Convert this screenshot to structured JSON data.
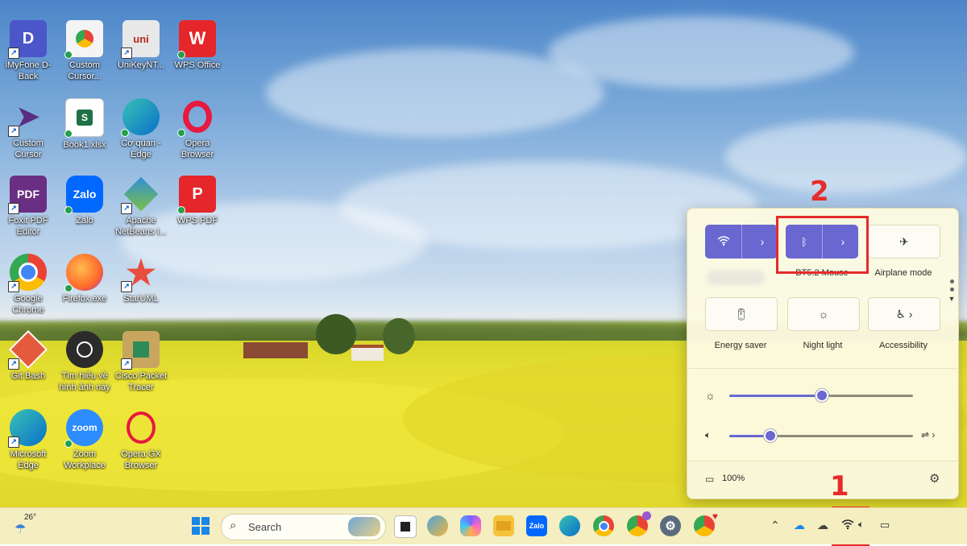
{
  "desktop_icons": [
    {
      "label": "iMyFone D-Back"
    },
    {
      "label": "Custom Cursor..."
    },
    {
      "label": "UniKeyNT..."
    },
    {
      "label": "WPS Office"
    },
    {
      "label": "Custom Cursor"
    },
    {
      "label": "Book1.xlsx"
    },
    {
      "label": "Cơ quan - Edge"
    },
    {
      "label": "Opera Browser"
    },
    {
      "label": "Foxit PDF Editor"
    },
    {
      "label": "Zalo"
    },
    {
      "label": "Apache NetBeans I..."
    },
    {
      "label": "WPS PDF"
    },
    {
      "label": "Google Chrome"
    },
    {
      "label": "Firefox.exe"
    },
    {
      "label": "StarUML"
    },
    {
      "label": "Git Bash"
    },
    {
      "label": "Tìm hiểu về hình ảnh này"
    },
    {
      "label": "Cisco Packet Tracer"
    },
    {
      "label": "Microsoft Edge"
    },
    {
      "label": "Zoom Workplace"
    },
    {
      "label": "Opera GX Browser"
    }
  ],
  "quick_settings": {
    "bluetooth_label": "BT5.2 Mouse",
    "airplane_label": "Airplane mode",
    "energy_label": "Energy saver",
    "night_label": "Night light",
    "accessibility_label": "Accessibility",
    "brightness_level": 0.5,
    "volume_level": 0.22,
    "battery_text": "100%"
  },
  "annotations": {
    "step1": "1",
    "step2": "2"
  },
  "taskbar": {
    "weather_temp": "26°",
    "search_placeholder": "Search",
    "zalo_text": "Zalo",
    "zoom_text": "zoom"
  }
}
